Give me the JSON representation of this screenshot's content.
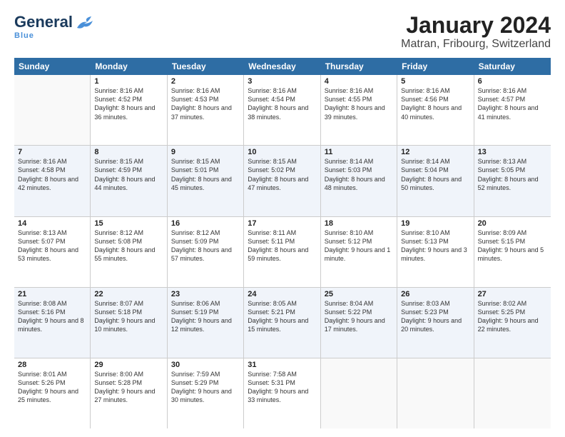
{
  "header": {
    "logo_general": "General",
    "logo_blue": "Blue",
    "title": "January 2024",
    "subtitle": "Matran, Fribourg, Switzerland"
  },
  "calendar": {
    "days_of_week": [
      "Sunday",
      "Monday",
      "Tuesday",
      "Wednesday",
      "Thursday",
      "Friday",
      "Saturday"
    ],
    "weeks": [
      [
        {
          "day": "",
          "sunrise": "",
          "sunset": "",
          "daylight": ""
        },
        {
          "day": "1",
          "sunrise": "Sunrise: 8:16 AM",
          "sunset": "Sunset: 4:52 PM",
          "daylight": "Daylight: 8 hours and 36 minutes."
        },
        {
          "day": "2",
          "sunrise": "Sunrise: 8:16 AM",
          "sunset": "Sunset: 4:53 PM",
          "daylight": "Daylight: 8 hours and 37 minutes."
        },
        {
          "day": "3",
          "sunrise": "Sunrise: 8:16 AM",
          "sunset": "Sunset: 4:54 PM",
          "daylight": "Daylight: 8 hours and 38 minutes."
        },
        {
          "day": "4",
          "sunrise": "Sunrise: 8:16 AM",
          "sunset": "Sunset: 4:55 PM",
          "daylight": "Daylight: 8 hours and 39 minutes."
        },
        {
          "day": "5",
          "sunrise": "Sunrise: 8:16 AM",
          "sunset": "Sunset: 4:56 PM",
          "daylight": "Daylight: 8 hours and 40 minutes."
        },
        {
          "day": "6",
          "sunrise": "Sunrise: 8:16 AM",
          "sunset": "Sunset: 4:57 PM",
          "daylight": "Daylight: 8 hours and 41 minutes."
        }
      ],
      [
        {
          "day": "7",
          "sunrise": "Sunrise: 8:16 AM",
          "sunset": "Sunset: 4:58 PM",
          "daylight": "Daylight: 8 hours and 42 minutes."
        },
        {
          "day": "8",
          "sunrise": "Sunrise: 8:15 AM",
          "sunset": "Sunset: 4:59 PM",
          "daylight": "Daylight: 8 hours and 44 minutes."
        },
        {
          "day": "9",
          "sunrise": "Sunrise: 8:15 AM",
          "sunset": "Sunset: 5:01 PM",
          "daylight": "Daylight: 8 hours and 45 minutes."
        },
        {
          "day": "10",
          "sunrise": "Sunrise: 8:15 AM",
          "sunset": "Sunset: 5:02 PM",
          "daylight": "Daylight: 8 hours and 47 minutes."
        },
        {
          "day": "11",
          "sunrise": "Sunrise: 8:14 AM",
          "sunset": "Sunset: 5:03 PM",
          "daylight": "Daylight: 8 hours and 48 minutes."
        },
        {
          "day": "12",
          "sunrise": "Sunrise: 8:14 AM",
          "sunset": "Sunset: 5:04 PM",
          "daylight": "Daylight: 8 hours and 50 minutes."
        },
        {
          "day": "13",
          "sunrise": "Sunrise: 8:13 AM",
          "sunset": "Sunset: 5:05 PM",
          "daylight": "Daylight: 8 hours and 52 minutes."
        }
      ],
      [
        {
          "day": "14",
          "sunrise": "Sunrise: 8:13 AM",
          "sunset": "Sunset: 5:07 PM",
          "daylight": "Daylight: 8 hours and 53 minutes."
        },
        {
          "day": "15",
          "sunrise": "Sunrise: 8:12 AM",
          "sunset": "Sunset: 5:08 PM",
          "daylight": "Daylight: 8 hours and 55 minutes."
        },
        {
          "day": "16",
          "sunrise": "Sunrise: 8:12 AM",
          "sunset": "Sunset: 5:09 PM",
          "daylight": "Daylight: 8 hours and 57 minutes."
        },
        {
          "day": "17",
          "sunrise": "Sunrise: 8:11 AM",
          "sunset": "Sunset: 5:11 PM",
          "daylight": "Daylight: 8 hours and 59 minutes."
        },
        {
          "day": "18",
          "sunrise": "Sunrise: 8:10 AM",
          "sunset": "Sunset: 5:12 PM",
          "daylight": "Daylight: 9 hours and 1 minute."
        },
        {
          "day": "19",
          "sunrise": "Sunrise: 8:10 AM",
          "sunset": "Sunset: 5:13 PM",
          "daylight": "Daylight: 9 hours and 3 minutes."
        },
        {
          "day": "20",
          "sunrise": "Sunrise: 8:09 AM",
          "sunset": "Sunset: 5:15 PM",
          "daylight": "Daylight: 9 hours and 5 minutes."
        }
      ],
      [
        {
          "day": "21",
          "sunrise": "Sunrise: 8:08 AM",
          "sunset": "Sunset: 5:16 PM",
          "daylight": "Daylight: 9 hours and 8 minutes."
        },
        {
          "day": "22",
          "sunrise": "Sunrise: 8:07 AM",
          "sunset": "Sunset: 5:18 PM",
          "daylight": "Daylight: 9 hours and 10 minutes."
        },
        {
          "day": "23",
          "sunrise": "Sunrise: 8:06 AM",
          "sunset": "Sunset: 5:19 PM",
          "daylight": "Daylight: 9 hours and 12 minutes."
        },
        {
          "day": "24",
          "sunrise": "Sunrise: 8:05 AM",
          "sunset": "Sunset: 5:21 PM",
          "daylight": "Daylight: 9 hours and 15 minutes."
        },
        {
          "day": "25",
          "sunrise": "Sunrise: 8:04 AM",
          "sunset": "Sunset: 5:22 PM",
          "daylight": "Daylight: 9 hours and 17 minutes."
        },
        {
          "day": "26",
          "sunrise": "Sunrise: 8:03 AM",
          "sunset": "Sunset: 5:23 PM",
          "daylight": "Daylight: 9 hours and 20 minutes."
        },
        {
          "day": "27",
          "sunrise": "Sunrise: 8:02 AM",
          "sunset": "Sunset: 5:25 PM",
          "daylight": "Daylight: 9 hours and 22 minutes."
        }
      ],
      [
        {
          "day": "28",
          "sunrise": "Sunrise: 8:01 AM",
          "sunset": "Sunset: 5:26 PM",
          "daylight": "Daylight: 9 hours and 25 minutes."
        },
        {
          "day": "29",
          "sunrise": "Sunrise: 8:00 AM",
          "sunset": "Sunset: 5:28 PM",
          "daylight": "Daylight: 9 hours and 27 minutes."
        },
        {
          "day": "30",
          "sunrise": "Sunrise: 7:59 AM",
          "sunset": "Sunset: 5:29 PM",
          "daylight": "Daylight: 9 hours and 30 minutes."
        },
        {
          "day": "31",
          "sunrise": "Sunrise: 7:58 AM",
          "sunset": "Sunset: 5:31 PM",
          "daylight": "Daylight: 9 hours and 33 minutes."
        },
        {
          "day": "",
          "sunrise": "",
          "sunset": "",
          "daylight": ""
        },
        {
          "day": "",
          "sunrise": "",
          "sunset": "",
          "daylight": ""
        },
        {
          "day": "",
          "sunrise": "",
          "sunset": "",
          "daylight": ""
        }
      ]
    ]
  }
}
